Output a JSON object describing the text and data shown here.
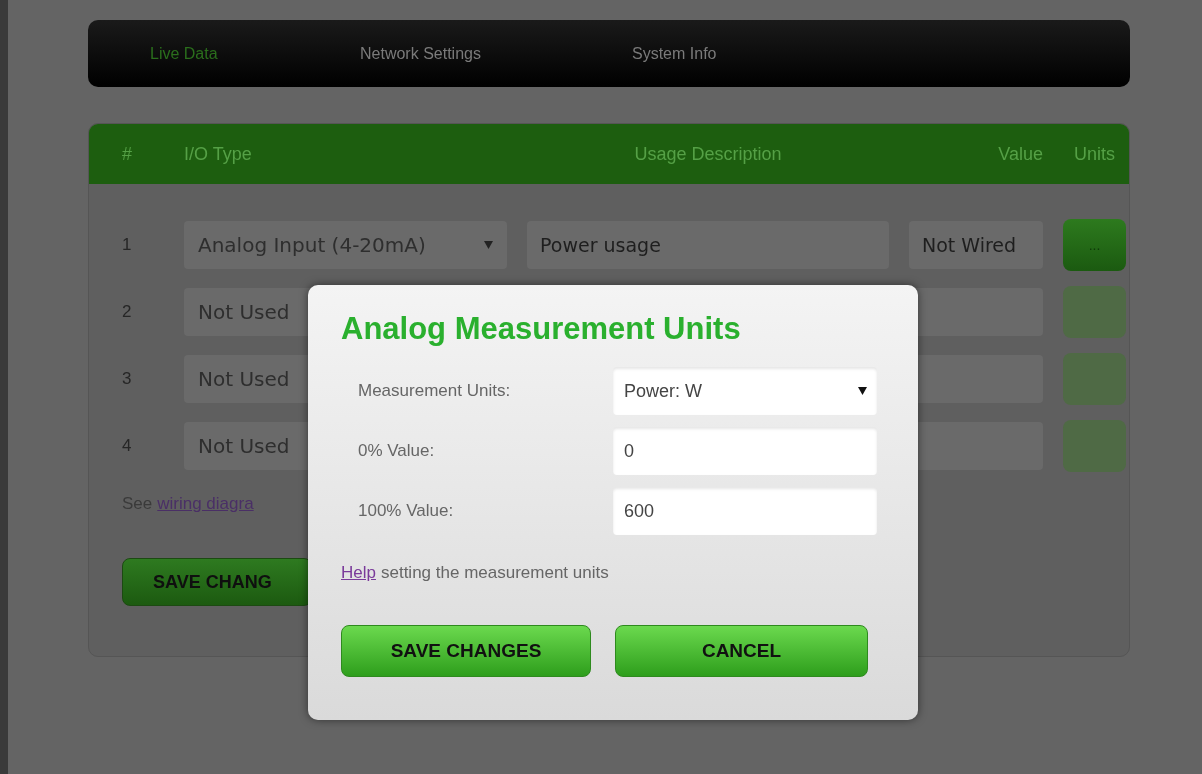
{
  "nav": {
    "tabs": [
      {
        "label": "Live Data",
        "selected": true
      },
      {
        "label": "Network Settings",
        "selected": false
      },
      {
        "label": "System Info",
        "selected": false
      }
    ]
  },
  "table": {
    "columns": [
      "#",
      "I/O Type",
      "Usage Description",
      "Value",
      "Units"
    ],
    "rows": [
      {
        "number": "1",
        "io_type": "Analog Input (4-20mA)",
        "description": "Power usage",
        "value": "Not Wired",
        "units_button": "...",
        "units_active": true
      },
      {
        "number": "2",
        "io_type": "Not Used",
        "units_active": false
      },
      {
        "number": "3",
        "io_type": "Not Used",
        "units_active": false
      },
      {
        "number": "4",
        "io_type": "Not Used",
        "units_active": false
      }
    ],
    "note": {
      "text": "See",
      "link": "wiring diagra"
    },
    "save_button": "SAVE CHANG"
  },
  "dialog": {
    "title": "Analog Measurement Units",
    "fields": [
      {
        "kind": "select",
        "label": "Measurement Units:",
        "value": "Power: W"
      },
      {
        "kind": "input",
        "label": "0% Value:",
        "value": "0"
      },
      {
        "kind": "input",
        "label": "100% Value:",
        "value": "600"
      }
    ],
    "help": {
      "link": "Help",
      "text": "setting the measurement units"
    },
    "buttons": [
      "SAVE CHANGES",
      "CANCEL"
    ]
  }
}
